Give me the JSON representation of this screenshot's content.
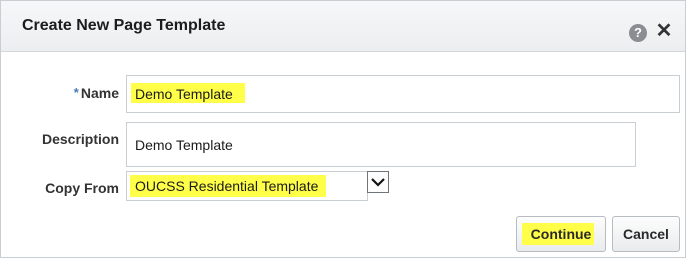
{
  "dialog": {
    "title": "Create New Page Template",
    "help_icon": "help-icon",
    "close_icon": "close-icon",
    "help_glyph": "?",
    "close_glyph": "✕"
  },
  "form": {
    "required_marker": "*",
    "name_label": "Name",
    "name_value": "Demo Template",
    "description_label": "Description",
    "description_value": "Demo Template",
    "copy_from_label": "Copy From",
    "copy_from_value": "OUCSS Residential Template"
  },
  "buttons": {
    "continue_label": "Continue",
    "cancel_label": "Cancel"
  },
  "colors": {
    "highlight": "#ffff4a",
    "required_marker": "#4a7db8"
  }
}
